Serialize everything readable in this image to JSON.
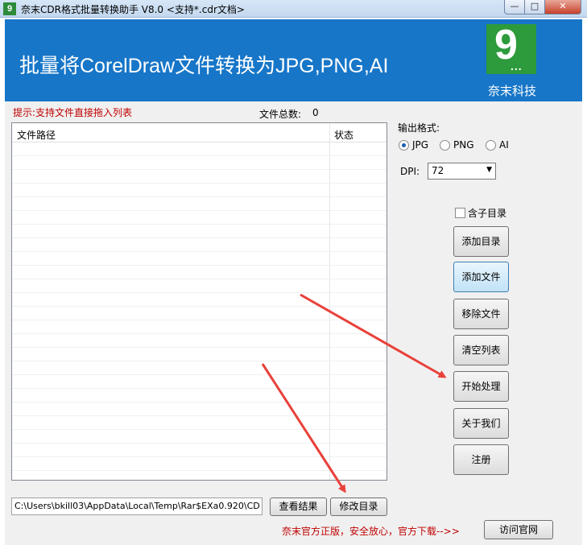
{
  "window": {
    "app_icon_glyph": "9",
    "title": "奈末CDR格式批量转换助手 V8.0    <支持*.cdr文档>",
    "minimize_glyph": "—",
    "maximize_glyph": "□",
    "close_glyph": "✕"
  },
  "banner": {
    "title": "批量将CorelDraw文件转换为JPG,PNG,AI",
    "logo_digit": "9",
    "logo_dots": "...",
    "brand_name": "奈末科技"
  },
  "file_panel": {
    "hint": "提示:支持文件直接拖入列表",
    "count_label": "文件总数:",
    "count_value": "0",
    "columns": [
      "文件路径",
      "状态"
    ],
    "rows": []
  },
  "settings": {
    "format_label": "输出格式:",
    "formats": [
      {
        "label": "JPG",
        "selected": true
      },
      {
        "label": "PNG",
        "selected": false
      },
      {
        "label": "AI",
        "selected": false
      }
    ],
    "dpi_label": "DPI:",
    "dpi_value": "72",
    "include_subdir_label": "含子目录",
    "include_subdir_checked": false
  },
  "actions": {
    "add_folder": "添加目录",
    "add_file": "添加文件",
    "remove_file": "移除文件",
    "clear_list": "清空列表",
    "start": "开始处理",
    "about": "关于我们",
    "register": "注册"
  },
  "output": {
    "path": "C:\\Users\\bkill03\\AppData\\Local\\Temp\\Rar$EXa0.920\\CD",
    "view_results": "查看结果",
    "change_folder": "修改目录"
  },
  "footer": {
    "promo": "奈末官方正版，安全放心，官方下载-->>",
    "visit_site": "访问官网"
  },
  "colors": {
    "banner_blue": "#1776c8",
    "logo_green": "#2d9a3c",
    "hint_red": "#c00000",
    "arrow_red": "#e8413a"
  }
}
